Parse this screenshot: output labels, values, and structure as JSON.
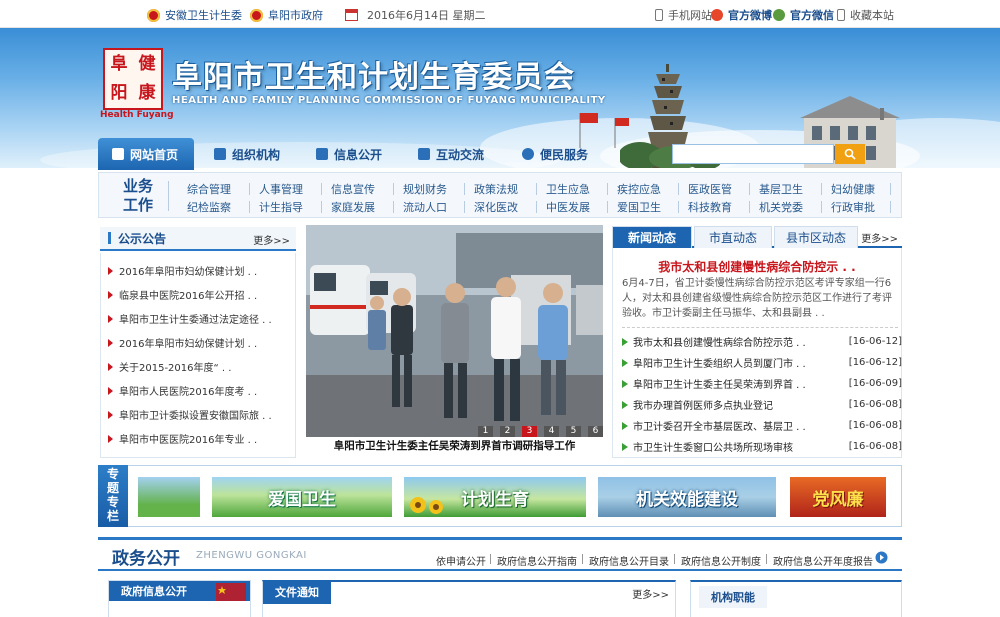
{
  "topbar": {
    "links": [
      "安徽卫生计生委",
      "阜阳市政府"
    ],
    "date": "2016年6月14日 星期二",
    "right": [
      "手机网站",
      "官方微博",
      "官方微信",
      "收藏本站"
    ]
  },
  "header": {
    "logo_chars": [
      "阜",
      "健",
      "阳",
      "康"
    ],
    "logo_en": "Health Fuyang",
    "title_cn": "阜阳市卫生和计划生育委员会",
    "title_en": "HEALTH AND FAMILY PLANNING COMMISSION OF FUYANG MUNICIPALITY"
  },
  "nav": {
    "items": [
      "网站首页",
      "组织机构",
      "信息公开",
      "互动交流",
      "便民服务"
    ],
    "active": "网站首页"
  },
  "search": {
    "placeholder": ""
  },
  "business": {
    "title_line1": "业务",
    "title_line2": "工作",
    "row1": [
      "综合管理",
      "人事管理",
      "信息宣传",
      "规划财务",
      "政策法规",
      "卫生应急",
      "疾控应急",
      "医政医管",
      "基层卫生",
      "妇幼健康"
    ],
    "row2": [
      "纪检监察",
      "计生指导",
      "家庭发展",
      "流动人口",
      "深化医改",
      "中医发展",
      "爱国卫生",
      "科技教育",
      "机关党委",
      "行政审批"
    ]
  },
  "announcements": {
    "title": "公示公告",
    "more": "更多>>",
    "items": [
      "2016年阜阳市妇幼保健计划 . .",
      "临泉县中医院2016年公开招 . .",
      "阜阳市卫生计生委通过法定途径 . .",
      "2016年阜阳市妇幼保健计划 . .",
      "关于2015-2016年度“ . .",
      "阜阳市人民医院2016年度考 . .",
      "阜阳市卫计委拟设置安徽国际旅 . .",
      "阜阳市中医医院2016年专业 . ."
    ]
  },
  "slideshow": {
    "caption": "阜阳市卫生计生委主任吴荣涛到界首市调研指导工作",
    "pages": [
      "1",
      "2",
      "3",
      "4",
      "5",
      "6"
    ],
    "active_page": 3
  },
  "news": {
    "tabs": [
      "新闻动态",
      "市直动态",
      "县市区动态"
    ],
    "more": "更多>>",
    "headline": "我市太和县创建慢性病综合防控示 . .",
    "summary": "6月4-7日，省卫计委慢性病综合防控示范区考评专家组一行6人，对太和县创建省级慢性病综合防控示范区工作进行了考评验收。市卫计委副主任马振华、太和县副县 . .",
    "items": [
      {
        "title": "我市太和县创建慢性病综合防控示范 . .",
        "date": "[16-06-12]"
      },
      {
        "title": "阜阳市卫生计生委组织人员到厦门市 . .",
        "date": "[16-06-12]"
      },
      {
        "title": "阜阳市卫生计生委主任吴荣涛到界首 . .",
        "date": "[16-06-09]"
      },
      {
        "title": "我市办理首例医师多点执业登记",
        "date": "[16-06-08]"
      },
      {
        "title": "市卫计委召开全市基层医改、基层卫 . .",
        "date": "[16-06-08]"
      },
      {
        "title": "市卫生计生委窗口公共场所现场审核",
        "date": "[16-06-08]"
      }
    ]
  },
  "topics": {
    "label": "专题专栏",
    "items": [
      "爱国卫生",
      "计划生育",
      "机关效能建设",
      "党风廉"
    ]
  },
  "gov": {
    "title": "政务公开",
    "subtitle": "ZHENGWU GONGKAI",
    "links": [
      "依申请公开",
      "政府信息公开指南",
      "政府信息公开目录",
      "政府信息公开制度",
      "政府信息公开年度报告"
    ],
    "panels": {
      "left": "政府信息公开",
      "mid": "文件通知",
      "mid_more": "更多>>",
      "right": "机构职能"
    }
  }
}
